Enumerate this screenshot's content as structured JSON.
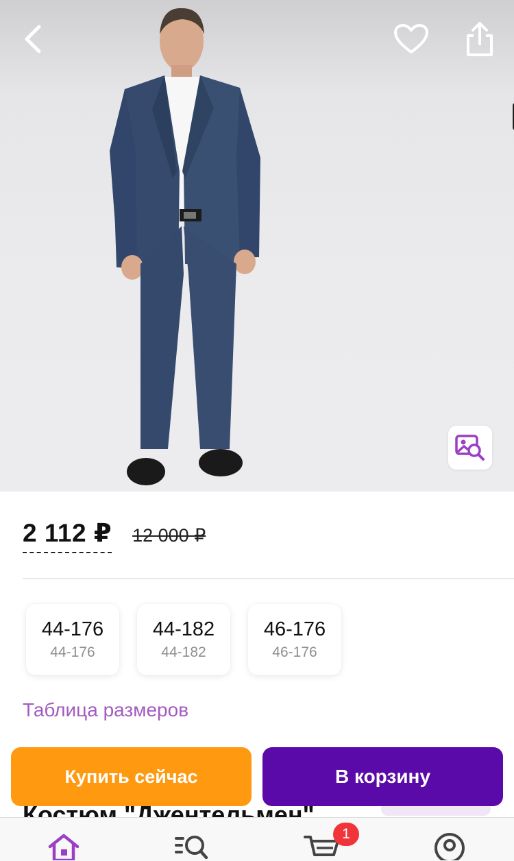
{
  "product": {
    "price_current": "2 112 ₽",
    "price_old": "12 000 ₽",
    "title": "Костюм \"Джентельмен\""
  },
  "sizes": [
    {
      "label": "44-176",
      "sub": "44-176"
    },
    {
      "label": "44-182",
      "sub": "44-182"
    },
    {
      "label": "46-176",
      "sub": "46-176"
    }
  ],
  "size_table_link": "Таблица размеров",
  "actions": {
    "buy_now": "Купить сейчас",
    "add_to_cart": "В корзину"
  },
  "tabbar": {
    "active": "home",
    "cart_count": "1",
    "icons": [
      "home-icon",
      "catalog-search-icon",
      "cart-icon",
      "profile-icon"
    ]
  },
  "icons": {
    "back": "chevron-left-icon",
    "favorite": "heart-icon",
    "share": "share-icon",
    "visual_search": "image-search-icon"
  },
  "colors": {
    "accent_purple": "#5a0aa8",
    "buy_orange": "#ff9a10",
    "link_purple": "#a35bbf",
    "badge_red": "#f1343a",
    "active_tab": "#9b3fc4"
  }
}
